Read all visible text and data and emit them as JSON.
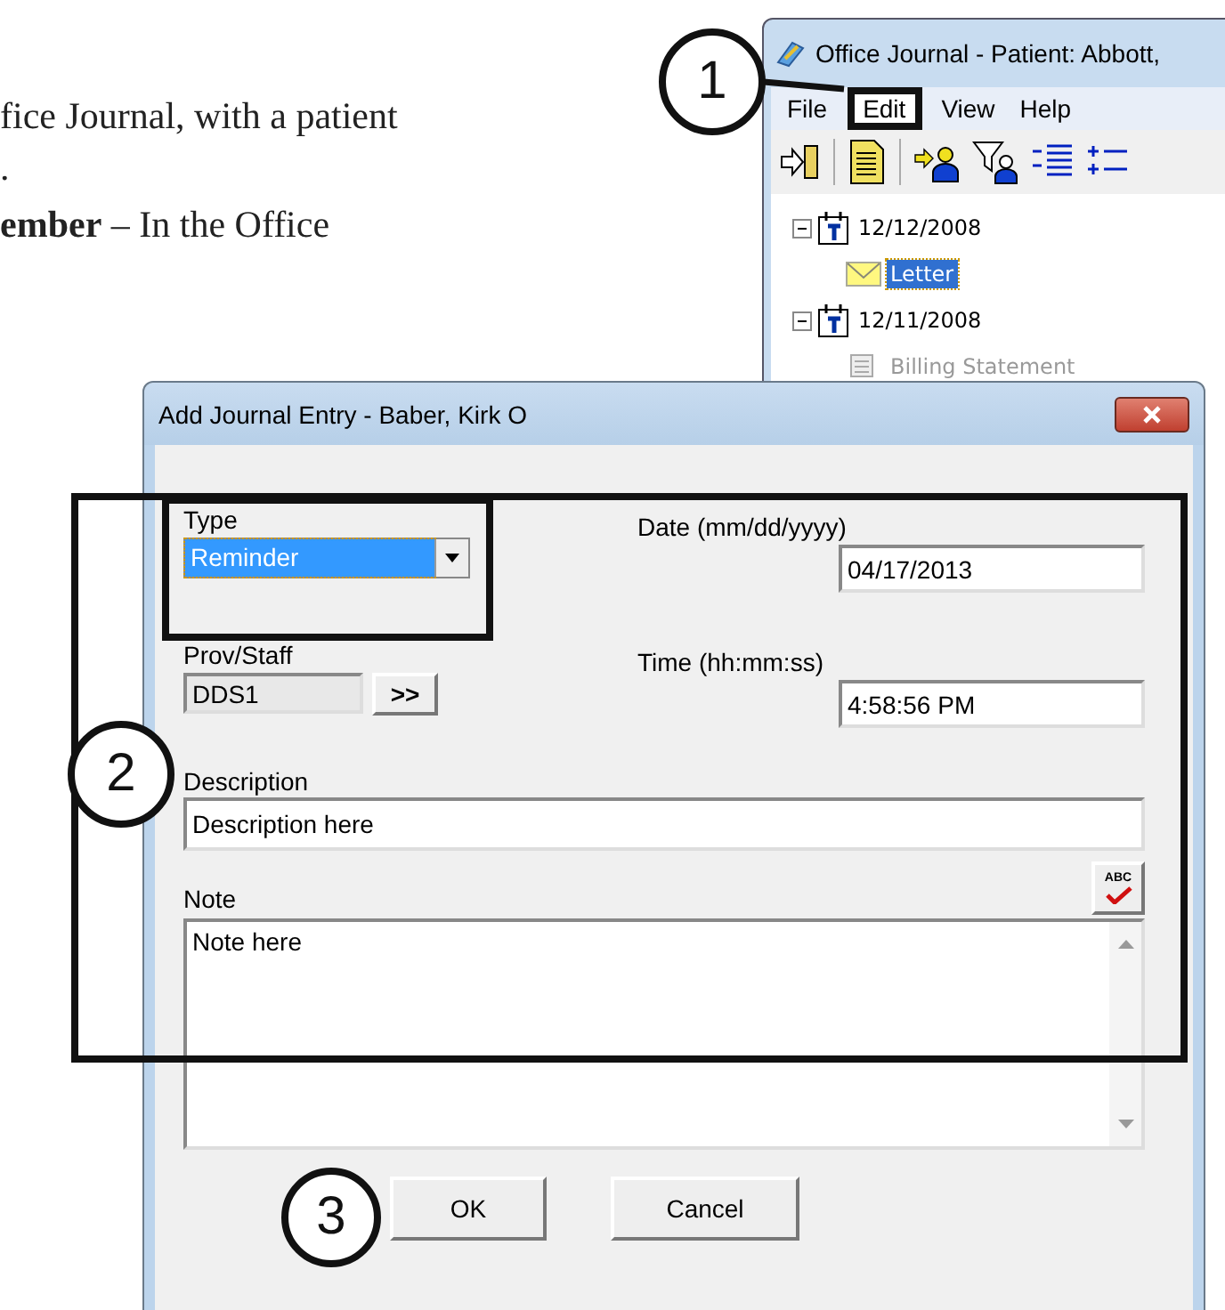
{
  "document_text": [
    "fice Journal, with a patient",
    ".",
    "**ember** –  In the Office"
  ],
  "background_window": {
    "title": "Office Journal - Patient: Abbott,",
    "menu": [
      {
        "label": "File",
        "highlighted": false
      },
      {
        "label": "Edit",
        "highlighted": true
      },
      {
        "label": "View",
        "highlighted": false
      },
      {
        "label": "Help",
        "highlighted": false
      }
    ],
    "tree": [
      {
        "label": "12/12/2008",
        "expanded": true,
        "selected": false,
        "children": [
          {
            "label": "Letter",
            "selected": true
          }
        ]
      },
      {
        "label": "12/11/2008",
        "expanded": true,
        "selected": false,
        "children": [
          {
            "label": "Billing Statement",
            "selected": false
          }
        ]
      }
    ]
  },
  "dialog": {
    "title": "Add Journal Entry - Baber, Kirk O",
    "type": {
      "label": "Type",
      "value": "Reminder"
    },
    "date": {
      "label": "Date (mm/dd/yyyy)",
      "value": "04/17/2013"
    },
    "prov_staff": {
      "label": "Prov/Staff",
      "value": "DDS1",
      "disabled": true,
      "button": ">>"
    },
    "time": {
      "label": "Time (hh:mm:ss)",
      "value": "4:58:56 PM"
    },
    "description": {
      "label": "Description",
      "value": "Description here"
    },
    "spell_button": "ABC",
    "note": {
      "label": "Note",
      "value": "Note here"
    },
    "buttons": [
      "OK",
      "Cancel"
    ]
  },
  "callouts": [
    "1",
    "2",
    "3"
  ]
}
